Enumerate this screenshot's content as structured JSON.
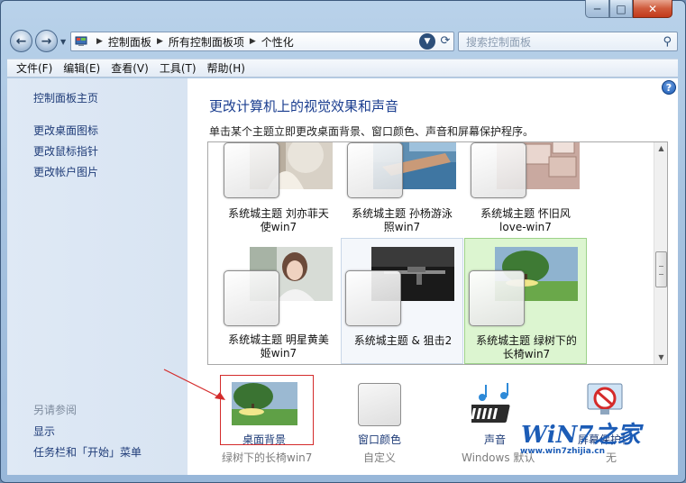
{
  "breadcrumb": {
    "items": [
      "控制面板",
      "所有控制面板项",
      "个性化"
    ]
  },
  "search": {
    "placeholder": "搜索控制面板"
  },
  "menu": {
    "items": [
      "文件(F)",
      "编辑(E)",
      "查看(V)",
      "工具(T)",
      "帮助(H)"
    ]
  },
  "sidebar": {
    "home_link": "控制面板主页",
    "links": [
      "更改桌面图标",
      "更改鼠标指针",
      "更改帐户图片"
    ],
    "see_also_heading": "另请参阅",
    "see_also_links": [
      "显示",
      "任务栏和「开始」菜单"
    ]
  },
  "main": {
    "title": "更改计算机上的视觉效果和声音",
    "subtitle": "单击某个主题立即更改桌面背景、窗口颜色、声音和屏幕保护程序。",
    "help_icon": "?"
  },
  "themes": [
    {
      "line1": "系统城主题 刘亦菲天",
      "line2": "使win7",
      "state": "normal"
    },
    {
      "line1": "系统城主题 孙杨游泳",
      "line2": "照win7",
      "state": "normal"
    },
    {
      "line1": "系统城主题 怀旧风",
      "line2": "love-win7",
      "state": "normal"
    },
    {
      "line1": "系统城主题 明星黄美",
      "line2": "姬win7",
      "state": "normal"
    },
    {
      "line1": "系统城主题 & 狙击2",
      "line2": "",
      "state": "hover"
    },
    {
      "line1": "系统城主题 绿树下的",
      "line2": "长椅win7",
      "state": "selected"
    }
  ],
  "settings": [
    {
      "label": "桌面背景",
      "sub": "绿树下的长椅win7"
    },
    {
      "label": "窗口颜色",
      "sub": "自定义"
    },
    {
      "label": "声音",
      "sub": "Windows 默认"
    },
    {
      "label": "屏幕保护程序",
      "sub": "无"
    }
  ],
  "watermark": {
    "title": "WiN7之家",
    "url": "www.win7zhijia.cn"
  },
  "colors": {
    "link": "#1f3c78",
    "title": "#1a3d8f",
    "selected_tile": "#dcf5d0",
    "highlight_box": "#d42b2b"
  }
}
